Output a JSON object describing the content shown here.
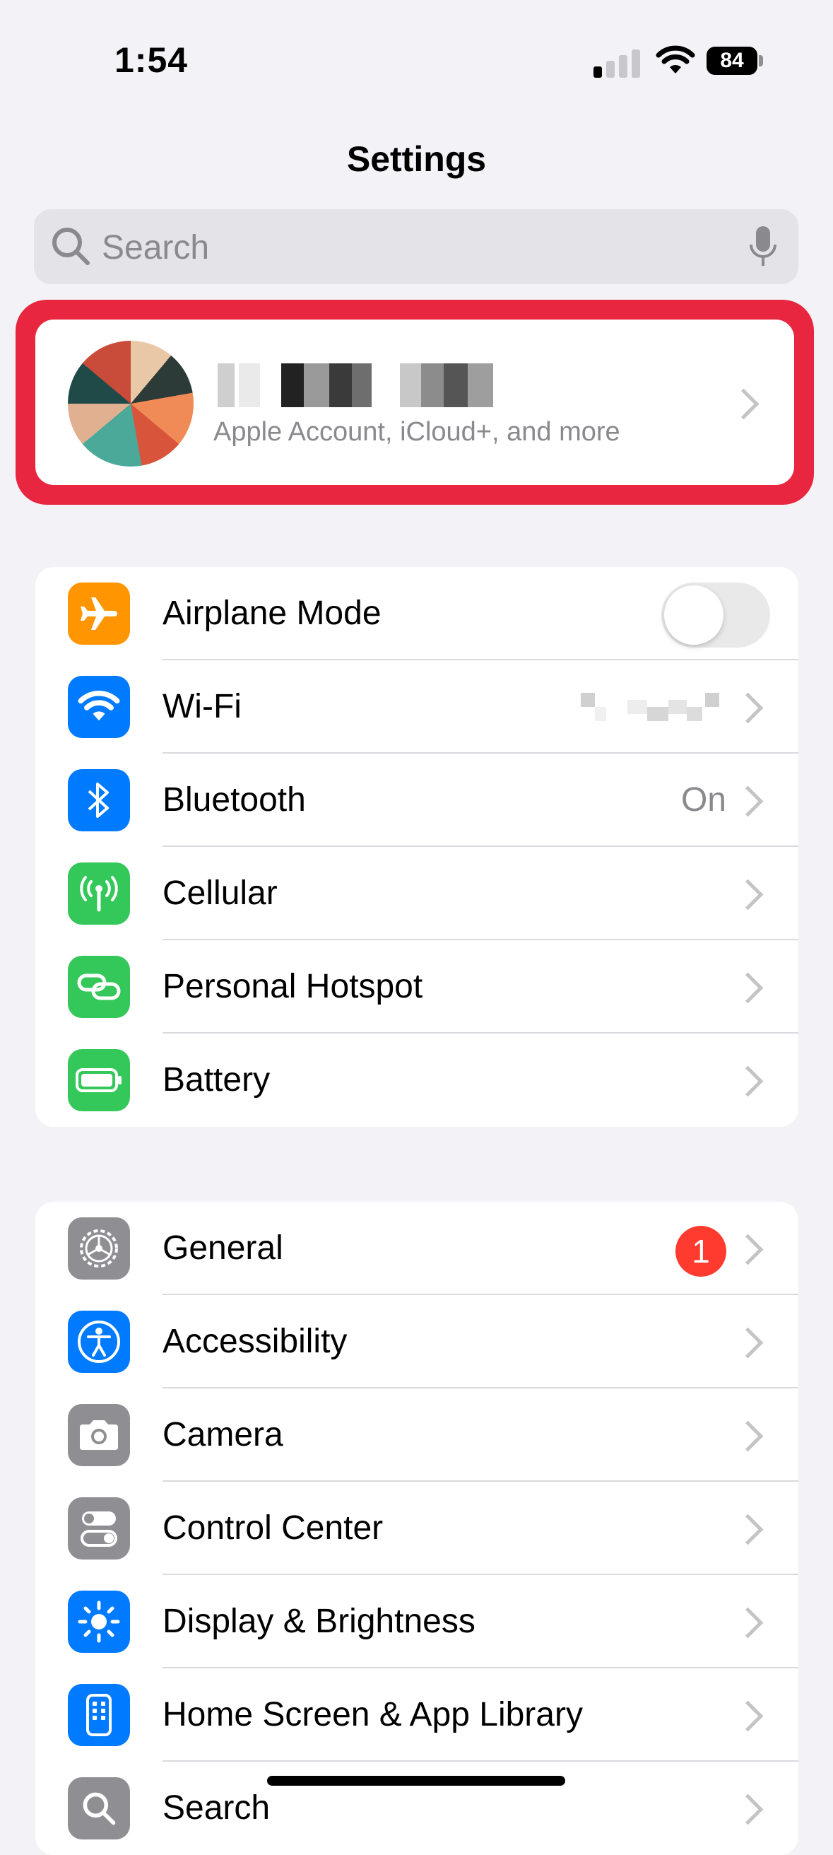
{
  "status_bar": {
    "time": "1:54",
    "battery_level": "84",
    "signal_bars_active": 1
  },
  "header": {
    "title": "Settings"
  },
  "search": {
    "placeholder": "Search"
  },
  "account": {
    "subtitle": "Apple Account, iCloud+, and more"
  },
  "group1": {
    "items": [
      {
        "label": "Airplane Mode",
        "icon": "airplane-icon",
        "color": "#FF9500",
        "toggle_on": false
      },
      {
        "label": "Wi-Fi",
        "icon": "wifi-icon",
        "color": "#007AFF"
      },
      {
        "label": "Bluetooth",
        "icon": "bluetooth-icon",
        "color": "#007AFF",
        "value": "On"
      },
      {
        "label": "Cellular",
        "icon": "antenna-icon",
        "color": "#34C759"
      },
      {
        "label": "Personal Hotspot",
        "icon": "link-icon",
        "color": "#34C759"
      },
      {
        "label": "Battery",
        "icon": "battery-icon",
        "color": "#34C759"
      }
    ]
  },
  "group2": {
    "items": [
      {
        "label": "General",
        "icon": "gear-icon",
        "color": "#8E8E93",
        "badge": "1"
      },
      {
        "label": "Accessibility",
        "icon": "accessibility-icon",
        "color": "#007AFF"
      },
      {
        "label": "Camera",
        "icon": "camera-icon",
        "color": "#8E8E93"
      },
      {
        "label": "Control Center",
        "icon": "toggles-icon",
        "color": "#8E8E93"
      },
      {
        "label": "Display & Brightness",
        "icon": "sun-icon",
        "color": "#007AFF"
      },
      {
        "label": "Home Screen & App Library",
        "icon": "phone-grid-icon",
        "color": "#007AFF"
      },
      {
        "label": "Search",
        "icon": "search-icon",
        "color": "#8E8E93"
      }
    ]
  }
}
